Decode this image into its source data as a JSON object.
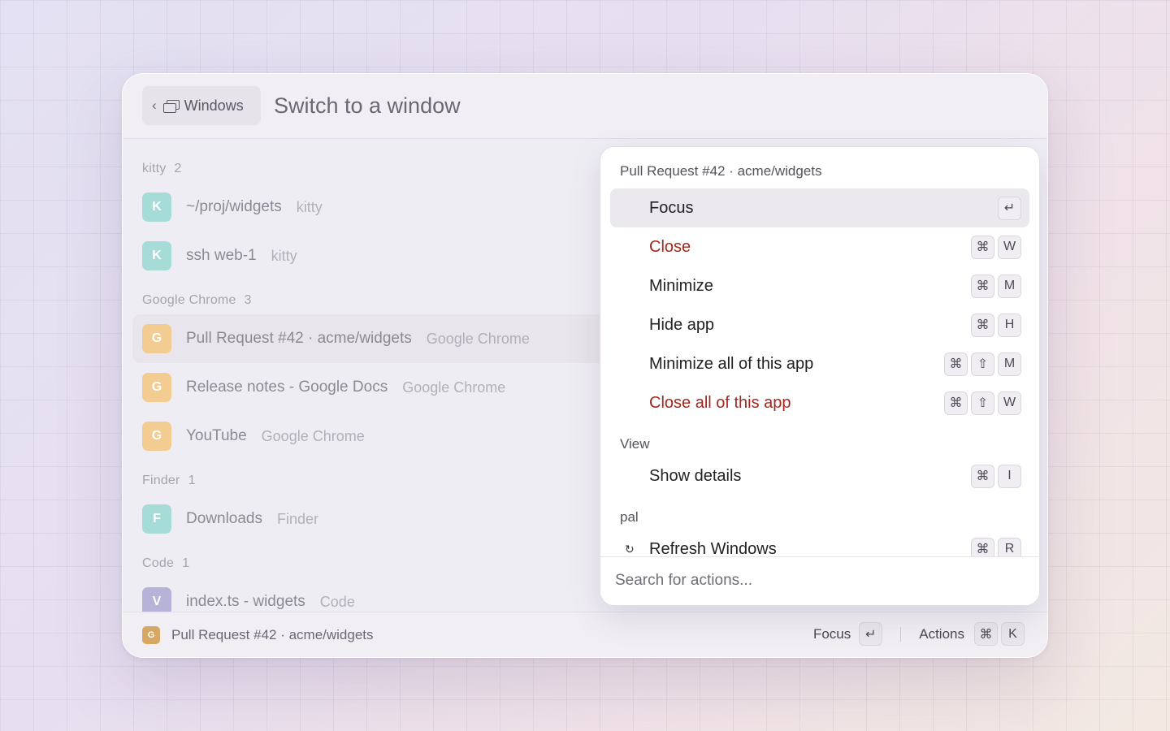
{
  "header": {
    "back_label": "Windows",
    "back_chevron": "‹",
    "title": "Switch to a window"
  },
  "groups": [
    {
      "name": "kitty",
      "count": "2",
      "items": [
        {
          "letter": "K",
          "title": "~/proj/widgets",
          "app": "kitty",
          "color": "#a6dcd8"
        },
        {
          "letter": "K",
          "title": "ssh web-1",
          "app": "kitty",
          "color": "#a6dcd8"
        }
      ]
    },
    {
      "name": "Google Chrome",
      "count": "3",
      "items": [
        {
          "letter": "G",
          "title": "Pull Request #42 · acme/widgets",
          "app": "Google Chrome",
          "color": "#f2cc90",
          "selected": true
        },
        {
          "letter": "G",
          "title": "Release notes - Google Docs",
          "app": "Google Chrome",
          "color": "#f2cc90"
        },
        {
          "letter": "G",
          "title": "YouTube",
          "app": "Google Chrome",
          "color": "#f2cc90"
        }
      ]
    },
    {
      "name": "Finder",
      "count": "1",
      "items": [
        {
          "letter": "F",
          "title": "Downloads",
          "app": "Finder",
          "color": "#a6dcd8"
        }
      ]
    },
    {
      "name": "Code",
      "count": "1",
      "items": [
        {
          "letter": "V",
          "title": "index.ts - widgets",
          "app": "Code",
          "color": "#b6b2d8"
        }
      ]
    }
  ],
  "actions_panel": {
    "window_title": "Pull Request #42 · acme/widgets",
    "actions": [
      {
        "label": "Focus",
        "keys": [
          "↵"
        ],
        "selected": true,
        "danger": false
      },
      {
        "label": "Close",
        "keys": [
          "⌘",
          "W"
        ],
        "danger": true
      },
      {
        "label": "Minimize",
        "keys": [
          "⌘",
          "M"
        ],
        "danger": false
      },
      {
        "label": "Hide app",
        "keys": [
          "⌘",
          "H"
        ],
        "danger": false
      },
      {
        "label": "Minimize all of this app",
        "keys": [
          "⌘",
          "⇧",
          "M"
        ],
        "danger": false
      },
      {
        "label": "Close all of this app",
        "keys": [
          "⌘",
          "⇧",
          "W"
        ],
        "danger": true
      }
    ],
    "view_section": "View",
    "view_actions": [
      {
        "label": "Show details",
        "keys": [
          "⌘",
          "I"
        ]
      }
    ],
    "pal_section": "pal",
    "pal_actions": [
      {
        "label": "Refresh Windows",
        "icon": "↻",
        "keys": [
          "⌘",
          "R"
        ]
      }
    ],
    "search_placeholder": "Search for actions..."
  },
  "footer": {
    "favicon_letter": "G",
    "selected_title": "Pull Request #42 · acme/widgets",
    "primary_label": "Focus",
    "primary_key": "↵",
    "actions_label": "Actions",
    "actions_keys": [
      "⌘",
      "K"
    ]
  }
}
